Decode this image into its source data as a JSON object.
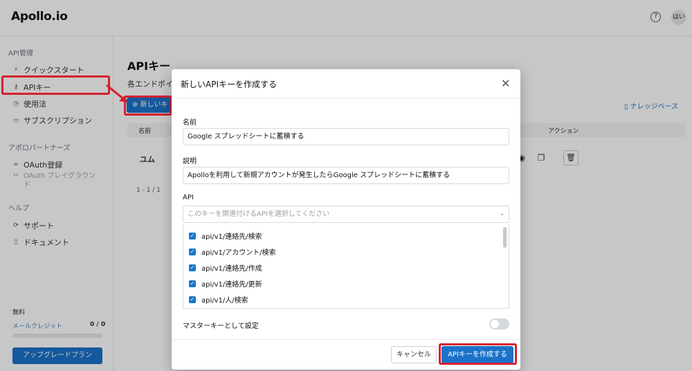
{
  "app": {
    "logo": "Apollo.io",
    "help_icon": "?",
    "avatar": "はい"
  },
  "sidebar": {
    "section_api": "API管理",
    "items_api": [
      {
        "label": "クイックスタート",
        "icon": "bolt-icon"
      },
      {
        "label": "APIキー",
        "icon": "key-icon"
      },
      {
        "label": "使用法",
        "icon": "clock-icon"
      },
      {
        "label": "サブスクリプション",
        "icon": "card-icon"
      }
    ],
    "section_partners": "アポロパートナーズ",
    "items_partners": [
      {
        "label": "OAuth登録",
        "icon": "link-icon"
      },
      {
        "label": "OAuth プレイグラウンド",
        "icon": "code-icon"
      }
    ],
    "section_help": "ヘルプ",
    "items_help": [
      {
        "label": "サポート",
        "icon": "support-icon"
      },
      {
        "label": "ドキュメント",
        "icon": "book-icon"
      }
    ],
    "plan_label": "無料",
    "credit_label": "メールクレジット",
    "credit_value": "0 / 0",
    "upgrade_label": "アップグレードプラン"
  },
  "main": {
    "title": "APIキー",
    "subtitle": "各エンドポイ",
    "new_key_label": "新しいキ",
    "kb_link": "ナレッジベース",
    "table": {
      "col_name": "名前",
      "col_action": "アクション",
      "rows": [
        {
          "name": "ユム"
        }
      ]
    },
    "pager": "1 - 1 / 1"
  },
  "modal": {
    "title": "新しいAPIキーを作成する",
    "name_label": "名前",
    "name_value": "Google スプレッドシートに蓄積する",
    "desc_label": "説明",
    "desc_value": "Apolloを利用して新規アカウントが発生したらGoogle スプレッドシートに蓄積する",
    "api_label": "API",
    "api_placeholder": "このキーを関連付けるAPIを選択してください",
    "api_options": [
      {
        "label": "api/v1/連絡先/検索",
        "checked": true
      },
      {
        "label": "api/v1/アカウント/検索",
        "checked": true
      },
      {
        "label": "api/v1/連絡先/作成",
        "checked": true
      },
      {
        "label": "api/v1/連絡先/更新",
        "checked": true
      },
      {
        "label": "api/v1/人/検索",
        "checked": true
      }
    ],
    "master_key_label": "マスターキーとして設定",
    "master_key_on": false,
    "cancel_label": "キャンセル",
    "create_label": "APIキーを作成する"
  },
  "colors": {
    "accent": "#1a73c9",
    "highlight": "#d6202e"
  }
}
